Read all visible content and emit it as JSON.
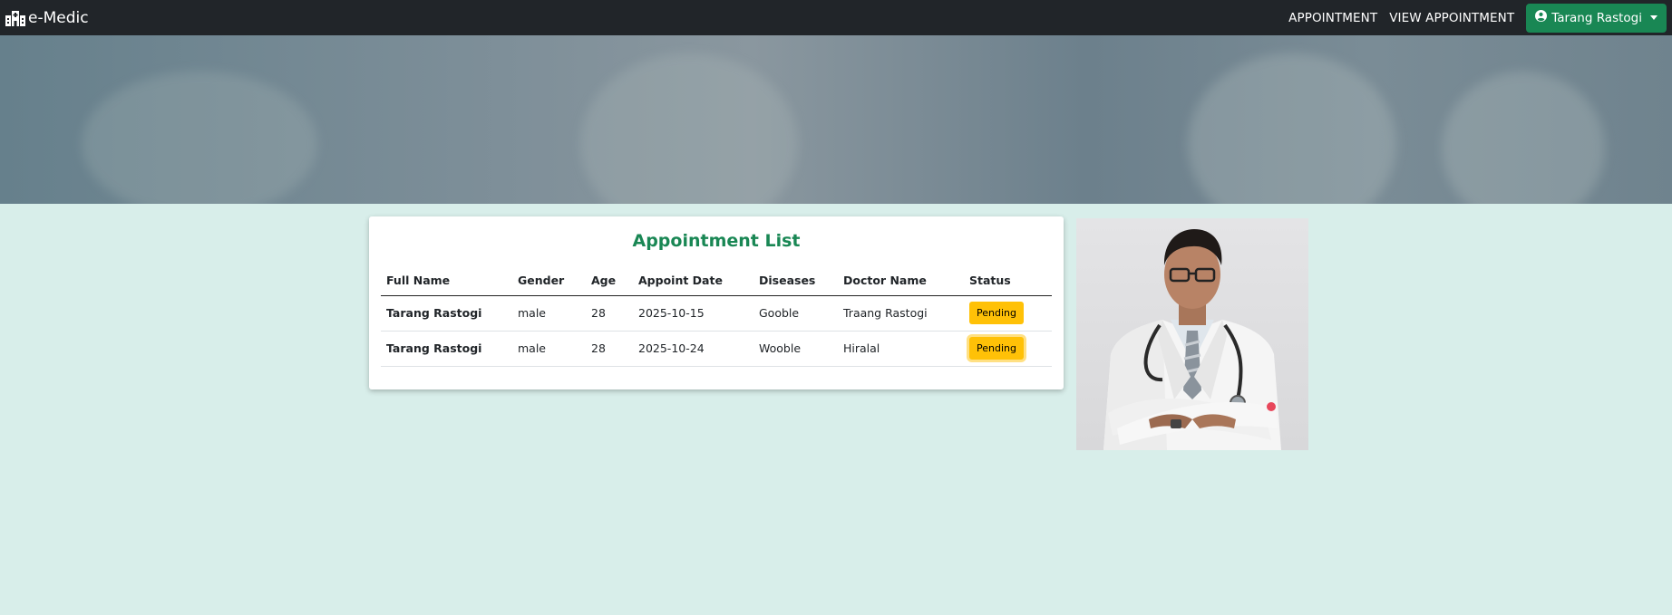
{
  "navbar": {
    "brand": "e-Medic",
    "links": [
      "APPOINTMENT",
      "VIEW APPOINTMENT"
    ],
    "user": "Tarang Rastogi"
  },
  "card": {
    "title": "Appointment List",
    "columns": [
      "Full Name",
      "Gender",
      "Age",
      "Appoint Date",
      "Diseases",
      "Doctor Name",
      "Status"
    ],
    "rows": [
      {
        "name": "Tarang Rastogi",
        "gender": "male",
        "age": "28",
        "date": "2025-10-15",
        "disease": "Gooble",
        "doctor": "Traang Rastogi",
        "status": "Pending"
      },
      {
        "name": "Tarang Rastogi",
        "gender": "male",
        "age": "28",
        "date": "2025-10-24",
        "disease": "Wooble",
        "doctor": "Hiralal",
        "status": "Pending"
      }
    ]
  },
  "colors": {
    "navbar_bg": "#212529",
    "accent_green": "#198754",
    "status_pending": "#ffc107",
    "page_bg": "#d8eeea"
  },
  "icons": [
    "hospital-icon",
    "user-circle-icon",
    "caret-down-icon"
  ]
}
